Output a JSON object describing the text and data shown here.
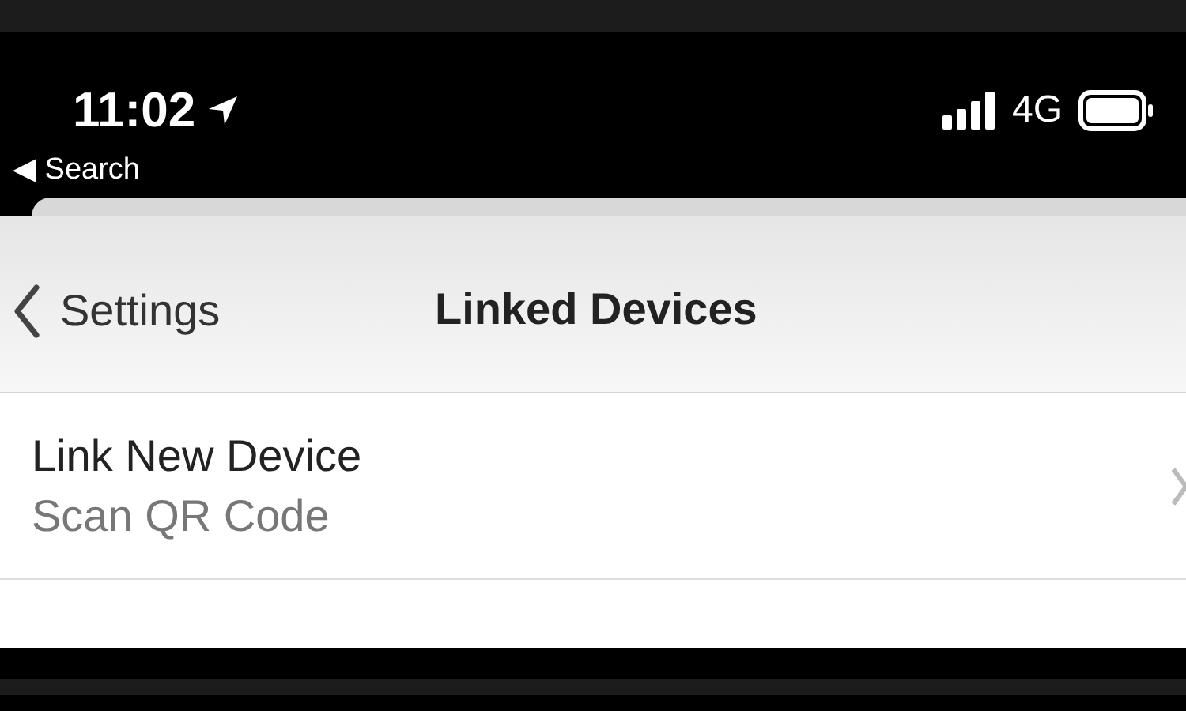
{
  "status_bar": {
    "time": "11:02",
    "back_label": "◀ Search",
    "network": "4G"
  },
  "nav_bar": {
    "back_label": "Settings",
    "title": "Linked Devices"
  },
  "rows": [
    {
      "title": "Link New Device",
      "subtitle": "Scan QR Code"
    }
  ]
}
